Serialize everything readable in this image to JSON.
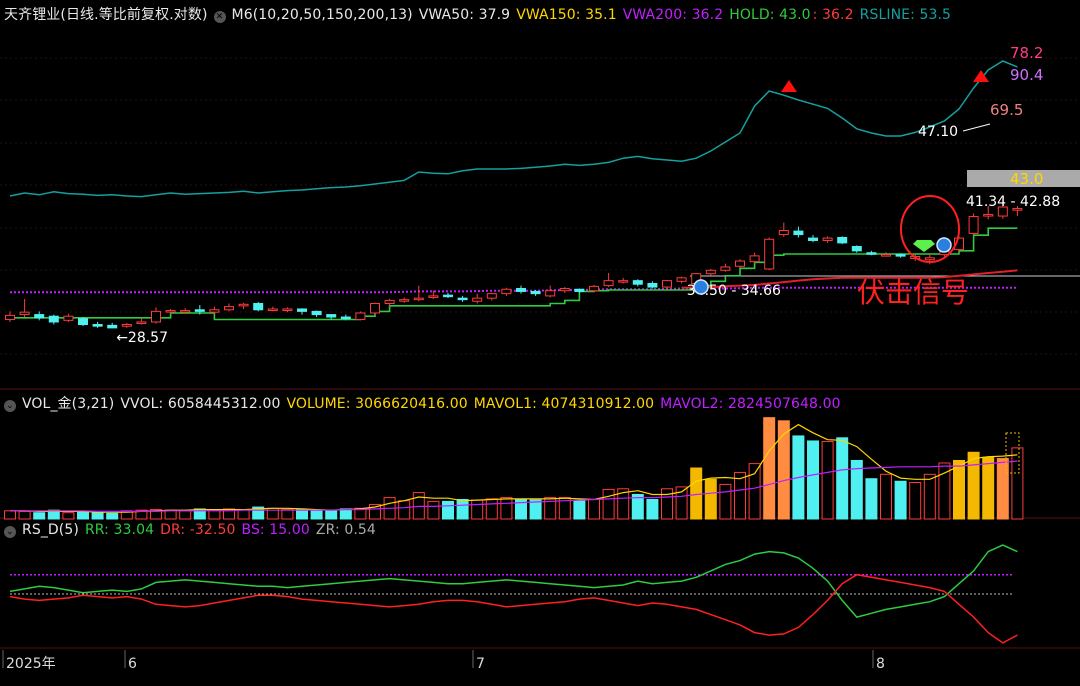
{
  "main": {
    "title": "天齐锂业(日线.等比前复权.对数)",
    "indicator": "M6(10,20,50,150,200,13)",
    "vwa50": "VWA50: 37.9",
    "vwa150": "VWA150: 35.1",
    "vwa200": "VWA200: 36.2",
    "hold_label": "HOLD: 43.0",
    "hold_red": ": 36.2",
    "rsline": "RSLINE: 53.5"
  },
  "volume_panel": {
    "title": "VOL_金(3,21)",
    "vvol": "VVOL: 6058445312.00",
    "volume": "VOLUME: 3066620416.00",
    "mavol1": "MAVOL1: 4074310912.00",
    "mavol2": "MAVOL2: 2824507648.00"
  },
  "rs_panel": {
    "title": "RS_D(5)",
    "rr": "RR: 33.04",
    "dr": "DR: -32.50",
    "bs": "BS: 15.00",
    "zr": "ZR: 0.54"
  },
  "colors": {
    "up": "#ff3b3b",
    "down": "#50f0f0",
    "hold": "#2ecc40",
    "rsline": "#15a0a0",
    "purple": "#c020ff",
    "yellow": "#ffd700",
    "orange_bar": "#ff8c40",
    "gold_bar": "#f5b800"
  },
  "chart_data": [
    {
      "type": "candlestick",
      "title": "天齐锂业(日线.等比前复权.对数)",
      "scale": "log",
      "x_labels": [
        "2025年",
        "6",
        "7",
        "8"
      ],
      "annotations": [
        "28.57",
        "34.50 - 34.66",
        "47.10",
        "69.5",
        "78.2",
        "90.4",
        "43.0",
        "41.34 - 42.88",
        "伏击信号"
      ],
      "candles": [
        {
          "o": 29.6,
          "c": 30.1,
          "h": 30.6,
          "l": 29.3
        },
        {
          "o": 30.2,
          "c": 30.5,
          "h": 32.2,
          "l": 29.9
        },
        {
          "o": 30.2,
          "c": 29.8,
          "h": 30.6,
          "l": 29.5
        },
        {
          "o": 30.0,
          "c": 29.3,
          "h": 30.2,
          "l": 29.0
        },
        {
          "o": 29.5,
          "c": 30.0,
          "h": 30.3,
          "l": 29.3
        },
        {
          "o": 29.7,
          "c": 29.0,
          "h": 29.9,
          "l": 28.8
        },
        {
          "o": 29.0,
          "c": 28.8,
          "h": 29.3,
          "l": 28.6
        },
        {
          "o": 28.9,
          "c": 28.6,
          "h": 29.2,
          "l": 28.57
        },
        {
          "o": 28.8,
          "c": 29.0,
          "h": 29.2,
          "l": 28.6
        },
        {
          "o": 29.2,
          "c": 29.3,
          "h": 29.8,
          "l": 29.0
        },
        {
          "o": 29.3,
          "c": 30.6,
          "h": 31.1,
          "l": 29.1
        },
        {
          "o": 30.6,
          "c": 30.7,
          "h": 30.9,
          "l": 30.3
        },
        {
          "o": 30.7,
          "c": 30.7,
          "h": 31.0,
          "l": 30.4
        },
        {
          "o": 30.8,
          "c": 30.6,
          "h": 31.4,
          "l": 30.2
        },
        {
          "o": 30.5,
          "c": 30.8,
          "h": 31.2,
          "l": 30.3
        },
        {
          "o": 30.8,
          "c": 31.2,
          "h": 31.6,
          "l": 30.6
        },
        {
          "o": 31.3,
          "c": 31.5,
          "h": 31.7,
          "l": 30.9
        },
        {
          "o": 31.6,
          "c": 30.8,
          "h": 31.8,
          "l": 30.6
        },
        {
          "o": 30.9,
          "c": 30.9,
          "h": 31.2,
          "l": 30.6
        },
        {
          "o": 30.9,
          "c": 30.9,
          "h": 31.1,
          "l": 30.5
        },
        {
          "o": 30.9,
          "c": 30.6,
          "h": 31.0,
          "l": 30.2
        },
        {
          "o": 30.6,
          "c": 30.2,
          "h": 30.7,
          "l": 29.9
        },
        {
          "o": 30.2,
          "c": 29.9,
          "h": 30.2,
          "l": 29.6
        },
        {
          "o": 29.9,
          "c": 29.7,
          "h": 30.2,
          "l": 29.5
        },
        {
          "o": 29.6,
          "c": 30.4,
          "h": 30.6,
          "l": 29.5
        },
        {
          "o": 30.4,
          "c": 31.6,
          "h": 31.7,
          "l": 30.2
        },
        {
          "o": 31.6,
          "c": 32.0,
          "h": 32.2,
          "l": 31.2
        },
        {
          "o": 32.0,
          "c": 32.1,
          "h": 32.4,
          "l": 31.7
        },
        {
          "o": 32.1,
          "c": 32.3,
          "h": 34.0,
          "l": 31.9
        },
        {
          "o": 32.4,
          "c": 32.6,
          "h": 33.3,
          "l": 32.2
        },
        {
          "o": 32.7,
          "c": 32.5,
          "h": 33.0,
          "l": 32.3
        },
        {
          "o": 32.3,
          "c": 32.2,
          "h": 32.6,
          "l": 31.8
        },
        {
          "o": 31.9,
          "c": 32.3,
          "h": 32.9,
          "l": 31.6
        },
        {
          "o": 32.3,
          "c": 32.9,
          "h": 33.0,
          "l": 32.0
        },
        {
          "o": 32.9,
          "c": 33.5,
          "h": 33.7,
          "l": 32.6
        },
        {
          "o": 33.6,
          "c": 33.2,
          "h": 34.0,
          "l": 32.9
        },
        {
          "o": 33.2,
          "c": 32.9,
          "h": 33.4,
          "l": 32.6
        },
        {
          "o": 32.6,
          "c": 33.3,
          "h": 34.0,
          "l": 32.4
        },
        {
          "o": 33.3,
          "c": 33.6,
          "h": 33.8,
          "l": 33.0
        },
        {
          "o": 33.5,
          "c": 33.2,
          "h": 33.6,
          "l": 33.0
        },
        {
          "o": 33.3,
          "c": 33.9,
          "h": 34.1,
          "l": 33.1
        },
        {
          "o": 34.0,
          "c": 34.7,
          "h": 35.8,
          "l": 33.8
        },
        {
          "o": 34.6,
          "c": 34.7,
          "h": 35.1,
          "l": 34.3
        },
        {
          "o": 34.7,
          "c": 34.2,
          "h": 34.9,
          "l": 33.9
        },
        {
          "o": 34.3,
          "c": 33.8,
          "h": 34.6,
          "l": 33.6
        },
        {
          "o": 33.8,
          "c": 34.7,
          "h": 34.8,
          "l": 33.4
        },
        {
          "o": 34.6,
          "c": 35.1,
          "h": 35.3,
          "l": 34.3
        },
        {
          "o": 34.3,
          "c": 35.7,
          "h": 35.8,
          "l": 34.1
        },
        {
          "o": 35.7,
          "c": 36.2,
          "h": 36.4,
          "l": 35.4
        },
        {
          "o": 36.2,
          "c": 36.7,
          "h": 37.2,
          "l": 36.0
        },
        {
          "o": 36.8,
          "c": 37.6,
          "h": 37.9,
          "l": 36.5
        },
        {
          "o": 37.5,
          "c": 38.4,
          "h": 38.9,
          "l": 37.2
        },
        {
          "o": 36.4,
          "c": 41.1,
          "h": 41.4,
          "l": 36.2
        },
        {
          "o": 41.9,
          "c": 42.6,
          "h": 44.0,
          "l": 41.5
        },
        {
          "o": 42.5,
          "c": 41.9,
          "h": 43.3,
          "l": 41.4
        },
        {
          "o": 41.3,
          "c": 40.9,
          "h": 41.8,
          "l": 40.6
        },
        {
          "o": 40.9,
          "c": 41.3,
          "h": 41.6,
          "l": 40.5
        },
        {
          "o": 41.4,
          "c": 40.5,
          "h": 41.6,
          "l": 40.3
        },
        {
          "o": 39.9,
          "c": 39.2,
          "h": 40.1,
          "l": 38.9
        },
        {
          "o": 38.9,
          "c": 38.7,
          "h": 39.2,
          "l": 38.5
        },
        {
          "o": 38.6,
          "c": 38.6,
          "h": 39.0,
          "l": 38.3
        },
        {
          "o": 38.6,
          "c": 38.4,
          "h": 38.8,
          "l": 38.1
        },
        {
          "o": 38.0,
          "c": 38.3,
          "h": 38.6,
          "l": 37.6
        },
        {
          "o": 37.8,
          "c": 38.1,
          "h": 38.6,
          "l": 37.1
        },
        {
          "o": 38.6,
          "c": 39.5,
          "h": 41.0,
          "l": 38.3
        },
        {
          "o": 39.4,
          "c": 41.3,
          "h": 41.6,
          "l": 39.1
        },
        {
          "o": 42.1,
          "c": 45.1,
          "h": 45.7,
          "l": 41.8
        },
        {
          "o": 45.2,
          "c": 45.5,
          "h": 47.1,
          "l": 44.6
        },
        {
          "o": 45.2,
          "c": 46.9,
          "h": 48.0,
          "l": 44.7
        },
        {
          "o": 46.3,
          "c": 46.6,
          "h": 47.1,
          "l": 45.2
        }
      ],
      "lines": {
        "hold": [
          29.8,
          29.8,
          29.8,
          29.8,
          29.8,
          29.8,
          29.8,
          29.8,
          29.8,
          29.8,
          29.8,
          30.4,
          30.4,
          30.4,
          29.6,
          29.6,
          29.6,
          29.6,
          29.6,
          29.6,
          29.6,
          29.6,
          29.6,
          29.6,
          30.0,
          30.6,
          31.3,
          31.3,
          31.3,
          31.3,
          31.3,
          31.3,
          31.3,
          31.3,
          31.3,
          31.3,
          31.3,
          31.6,
          32.0,
          33.2,
          33.3,
          33.4,
          33.4,
          33.4,
          33.4,
          33.4,
          33.4,
          34.0,
          34.6,
          35.4,
          36.5,
          37.4,
          38.5,
          38.7,
          38.7,
          38.7,
          38.7,
          38.7,
          38.7,
          38.7,
          38.7,
          38.7,
          38.7,
          38.7,
          38.7,
          39.2,
          41.8,
          43.0,
          43.0,
          43.0
        ],
        "ma150": [
          33.1,
          33.1,
          33.1,
          33.1,
          33.1,
          33.1,
          33.1,
          33.1,
          33.1,
          33.1,
          33.1,
          33.1,
          33.1,
          33.1,
          33.1,
          33.1,
          33.1,
          33.1,
          33.1,
          33.1,
          33.1,
          33.1,
          33.1,
          33.1,
          33.1,
          33.1,
          33.1,
          33.15,
          33.2,
          33.2,
          33.2,
          33.2,
          33.25,
          33.3,
          33.3,
          33.3,
          33.3,
          33.35,
          33.4,
          33.4,
          33.45,
          33.5,
          33.5,
          33.5,
          33.5,
          33.55,
          33.6,
          33.6,
          33.6,
          33.6,
          33.65,
          33.7,
          33.7,
          33.7,
          33.7,
          33.7,
          33.7,
          33.7,
          33.7,
          33.7,
          33.7,
          33.7,
          33.7,
          33.7,
          33.7,
          33.7,
          33.7,
          33.7,
          33.7,
          33.7
        ],
        "ma200": [
          null,
          null,
          null,
          null,
          null,
          null,
          null,
          null,
          null,
          null,
          null,
          null,
          null,
          null,
          null,
          null,
          null,
          null,
          null,
          null,
          null,
          null,
          null,
          null,
          null,
          null,
          null,
          null,
          null,
          null,
          null,
          null,
          null,
          null,
          null,
          null,
          null,
          null,
          null,
          null,
          null,
          null,
          null,
          null,
          null,
          null,
          33.7,
          33.75,
          33.8,
          33.9,
          34.0,
          34.1,
          34.3,
          34.5,
          34.7,
          34.9,
          35.0,
          35.1,
          35.1,
          35.1,
          35.1,
          35.1,
          35.1,
          35.1,
          35.2,
          35.4,
          35.6,
          35.8,
          36.0,
          36.2
        ],
        "rsline": [
          39.0,
          39.5,
          39.2,
          39.7,
          39.4,
          39.3,
          39.1,
          39.2,
          39.0,
          38.9,
          39.2,
          39.5,
          39.3,
          39.4,
          39.5,
          39.6,
          39.8,
          39.5,
          39.7,
          39.9,
          40.0,
          40.2,
          40.4,
          40.5,
          40.7,
          41.0,
          41.3,
          41.6,
          43.0,
          42.8,
          42.7,
          43.2,
          43.5,
          43.5,
          43.5,
          43.6,
          43.8,
          44.0,
          44.3,
          44.1,
          44.3,
          44.6,
          45.3,
          45.6,
          45.2,
          45.0,
          44.8,
          45.3,
          46.5,
          48.0,
          49.5,
          54.0,
          56.5,
          55.8,
          55.0,
          54.3,
          53.6,
          52.0,
          50.2,
          49.5,
          49.0,
          49.0,
          49.6,
          50.5,
          51.5,
          53.5,
          57.0,
          60.0,
          61.5,
          60.5
        ]
      }
    },
    {
      "type": "bar",
      "title": "VOL_金(3,21)",
      "volume": [
        1.3,
        1.2,
        1.0,
        1.4,
        1.0,
        1.2,
        1.1,
        0.9,
        1.3,
        1.4,
        1.5,
        1.4,
        1.3,
        1.6,
        1.4,
        1.6,
        1.5,
        1.9,
        1.7,
        1.5,
        1.5,
        1.4,
        1.4,
        1.6,
        1.7,
        2.3,
        3.4,
        2.9,
        4.2,
        2.8,
        2.8,
        3.1,
        3.0,
        3.2,
        3.4,
        3.1,
        3.0,
        3.4,
        3.4,
        2.9,
        3.1,
        4.7,
        4.8,
        3.9,
        3.1,
        4.8,
        5.1,
        8.1,
        6.3,
        5.5,
        7.4,
        8.8,
        16.1,
        15.6,
        13.2,
        12.4,
        12.3,
        12.9,
        9.3,
        6.4,
        7.1,
        6.0,
        5.8,
        7.1,
        8.9,
        9.3,
        10.6,
        9.8,
        9.6,
        11.3
      ],
      "highlight": {
        "orange": [
          52,
          53,
          68
        ],
        "gold": [
          47,
          48,
          65,
          66,
          67
        ]
      },
      "mavol1": [
        1.3,
        1.3,
        1.2,
        1.2,
        1.2,
        1.2,
        1.1,
        1.1,
        1.1,
        1.2,
        1.3,
        1.4,
        1.4,
        1.5,
        1.5,
        1.5,
        1.5,
        1.6,
        1.7,
        1.7,
        1.6,
        1.5,
        1.4,
        1.5,
        1.6,
        1.9,
        2.5,
        2.9,
        3.5,
        3.3,
        3.3,
        2.9,
        3.0,
        3.1,
        3.2,
        3.2,
        3.2,
        3.2,
        3.3,
        3.2,
        3.1,
        3.6,
        4.2,
        4.5,
        3.9,
        3.9,
        4.3,
        6.0,
        6.5,
        6.6,
        6.4,
        7.2,
        10.8,
        13.5,
        15.0,
        13.7,
        12.6,
        12.5,
        11.5,
        9.5,
        7.6,
        6.5,
        6.3,
        6.3,
        7.3,
        8.4,
        9.6,
        9.9,
        10.0,
        10.2
      ],
      "mavol2": [
        1.3,
        1.3,
        1.3,
        1.3,
        1.3,
        1.3,
        1.2,
        1.2,
        1.2,
        1.2,
        1.2,
        1.3,
        1.3,
        1.3,
        1.3,
        1.3,
        1.4,
        1.4,
        1.4,
        1.4,
        1.4,
        1.4,
        1.4,
        1.5,
        1.5,
        1.6,
        1.7,
        1.8,
        2.0,
        2.0,
        2.1,
        2.2,
        2.3,
        2.4,
        2.5,
        2.6,
        2.7,
        2.8,
        2.9,
        3.0,
        3.1,
        3.2,
        3.3,
        3.4,
        3.4,
        3.5,
        3.6,
        3.9,
        4.1,
        4.3,
        4.6,
        4.9,
        5.5,
        6.1,
        6.6,
        7.0,
        7.4,
        7.8,
        8.0,
        8.1,
        8.2,
        8.3,
        8.3,
        8.3,
        8.4,
        8.4,
        8.6,
        8.8,
        9.0,
        9.2
      ]
    },
    {
      "type": "line",
      "title": "RS_D(5)",
      "rr": [
        2,
        4,
        6,
        5,
        3,
        1,
        2,
        3,
        2,
        4,
        9,
        10,
        11,
        10,
        9,
        8,
        7,
        6,
        6,
        5,
        6,
        7,
        8,
        9,
        10,
        11,
        12,
        11,
        10,
        9,
        8,
        8,
        9,
        10,
        11,
        10,
        9,
        8,
        7,
        6,
        5,
        6,
        7,
        10,
        8,
        9,
        10,
        13,
        18,
        23,
        26,
        31,
        33,
        32,
        28,
        20,
        10,
        -5,
        -18,
        -15,
        -12,
        -10,
        -8,
        -6,
        -2,
        8,
        18,
        33,
        38,
        33
      ],
      "dr": [
        -2,
        -4,
        -5,
        -4,
        -3,
        -1,
        -2,
        -3,
        -2,
        -4,
        -8,
        -9,
        -10,
        -9,
        -7,
        -5,
        -3,
        -1,
        -1,
        -2,
        -4,
        -5,
        -6,
        -7,
        -8,
        -9,
        -10,
        -9,
        -8,
        -6,
        -5,
        -5,
        -6,
        -8,
        -10,
        -9,
        -8,
        -7,
        -6,
        -4,
        -3,
        -5,
        -7,
        -9,
        -7,
        -8,
        -10,
        -12,
        -16,
        -20,
        -24,
        -30,
        -32,
        -31,
        -26,
        -16,
        -5,
        8,
        15,
        13,
        11,
        9,
        7,
        5,
        2,
        -8,
        -18,
        -30,
        -38,
        -32
      ],
      "bs": 15,
      "zr": 0,
      "ylim": [
        -42,
        42
      ]
    }
  ]
}
